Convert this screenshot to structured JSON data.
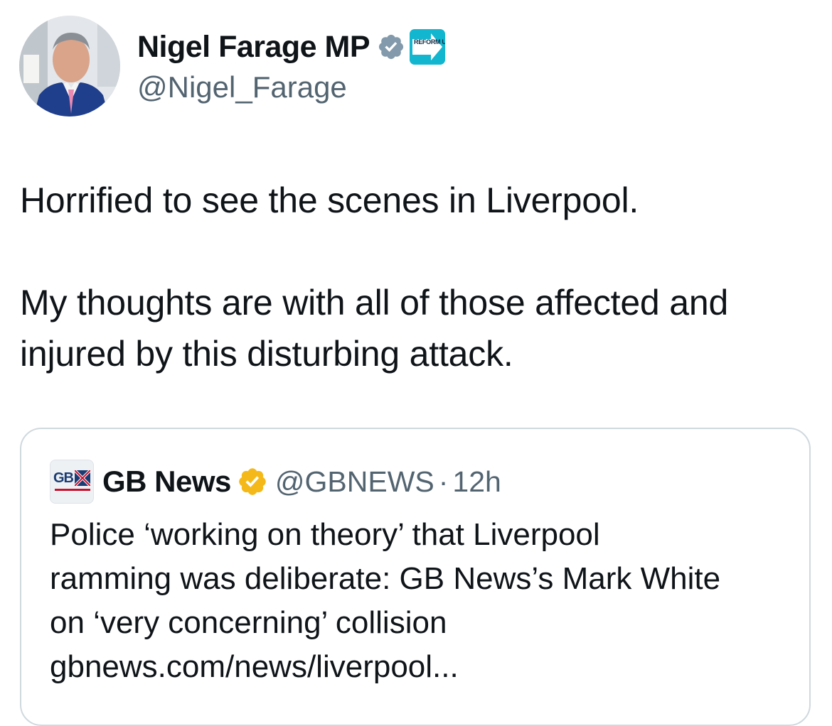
{
  "author": {
    "display_name": "Nigel Farage MP",
    "handle": "@Nigel_Farage",
    "verified_badge": "grey-verified-icon",
    "affiliation_badge": {
      "label": "REFORM UK",
      "color": "#12b6cf"
    }
  },
  "tweet": {
    "lines": [
      "Horrified to see the scenes in Liverpool.",
      "My thoughts are with all of those affected and injured by this disturbing attack."
    ]
  },
  "quoted_tweet": {
    "avatar_text": "GB",
    "display_name": "GB News",
    "verified_badge": "gold-verified-icon",
    "handle": "@GBNEWS",
    "separator": "·",
    "time": "12h",
    "text_lines": [
      "Police ‘working on theory’ that Liverpool",
      "ramming was deliberate: GB News’s Mark White",
      "on ‘very concerning’ collision",
      "gbnews.com/news/liverpool..."
    ]
  },
  "colors": {
    "text_primary": "#0f1419",
    "text_secondary": "#536471",
    "border": "#cfd9de",
    "gold": "#f4b919",
    "verified_grey": "#829aab"
  }
}
